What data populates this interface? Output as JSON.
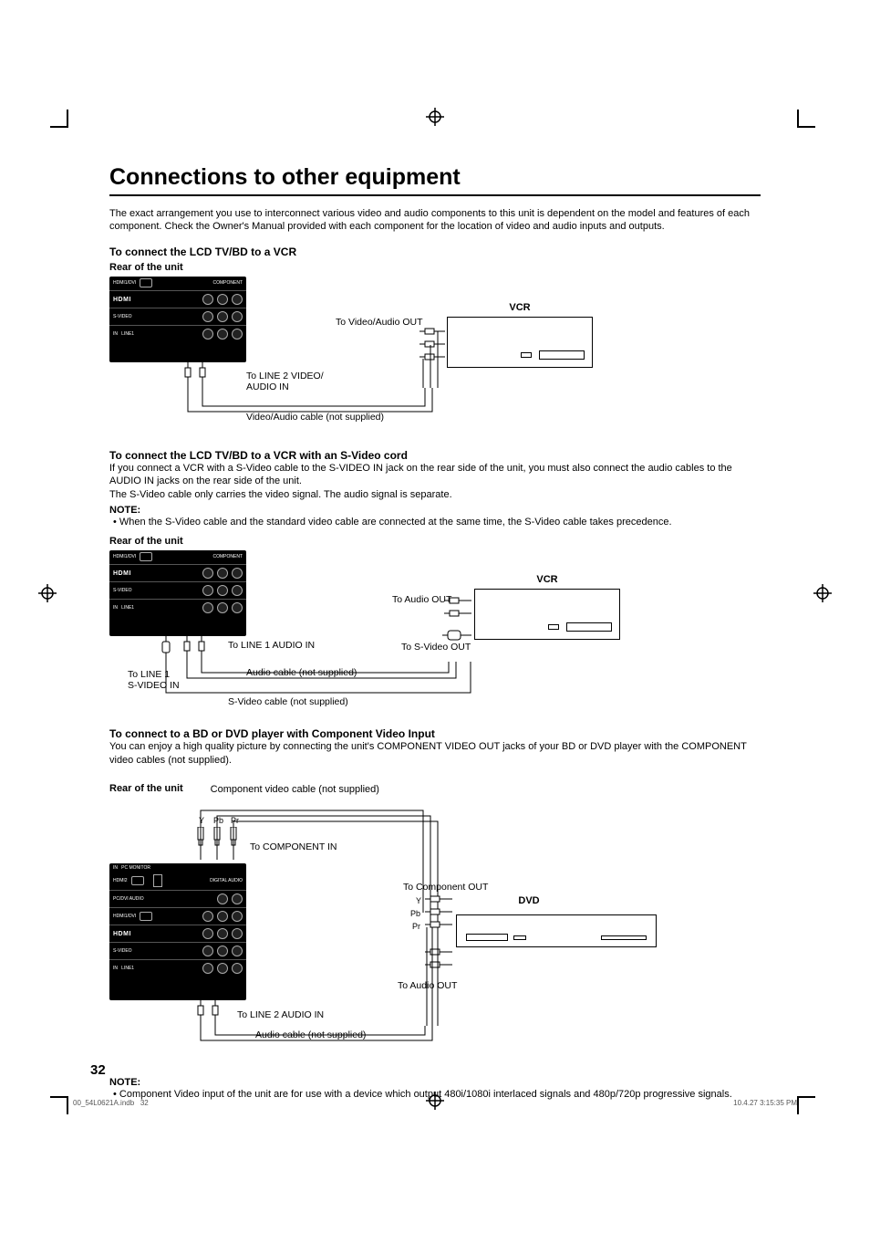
{
  "title": "Connections to other equipment",
  "intro": "The exact arrangement you use to interconnect various video and audio components to this unit is dependent on the model and features of each component. Check the Owner's Manual provided with each component for the location of video and audio inputs and outputs.",
  "section1": {
    "heading": "To connect the LCD TV/BD to a VCR",
    "rear_label": "Rear of the unit",
    "labels": {
      "to_line2": "To LINE 2 VIDEO/\nAUDIO IN",
      "cable": "Video/Audio cable (not supplied)",
      "to_va_out": "To Video/Audio OUT",
      "vcr": "VCR"
    }
  },
  "section2": {
    "heading": "To connect the LCD TV/BD to a VCR with an S-Video cord",
    "body1": "If you connect a VCR with a S-Video cable to the S-VIDEO IN jack on the rear side of the unit, you must also connect the audio cables to the AUDIO IN jacks on the rear side of the unit.",
    "body2": "The S-Video cable only carries the video signal. The audio signal is separate.",
    "note_heading": "NOTE:",
    "note_bullet": "•  When the S-Video cable and the standard video cable are connected at the same time, the S-Video cable takes precedence.",
    "rear_label": "Rear of the unit",
    "labels": {
      "to_line1_svideo": "To LINE 1\nS-VIDEO IN",
      "to_line1_audio": "To LINE 1 AUDIO IN",
      "audio_cable": "Audio cable (not supplied)",
      "svideo_cable": "S-Video cable (not supplied)",
      "to_audio_out": "To Audio OUT",
      "to_svideo_out": "To S-Video OUT",
      "vcr": "VCR"
    }
  },
  "section3": {
    "heading": "To connect to a BD or DVD player with Component Video Input",
    "body": "You can enjoy a high quality picture by connecting the unit's COMPONENT VIDEO OUT jacks of your BD or DVD player with the COMPONENT video cables (not supplied).",
    "rear_label": "Rear of the unit",
    "labels": {
      "component_cable": "Component video cable (not supplied)",
      "y": "Y",
      "pb": "Pb",
      "pr": "Pr",
      "to_component_in": "To COMPONENT IN",
      "to_component_out": "To Component OUT",
      "to_line2_audio": "To LINE 2 AUDIO IN",
      "audio_cable": "Audio cable (not supplied)",
      "to_audio_out": "To Audio OUT",
      "dvd": "DVD"
    },
    "note_heading": "NOTE:",
    "note_bullet": "•  Component Video input of the unit are for use with a device which output 480i/1080i interlaced signals and 480p/720p progressive signals."
  },
  "page_number": "32",
  "footer": {
    "left_file": "00_54L0621A.indb",
    "left_num": "32",
    "right": "10.4.27   3:15:35 PM"
  }
}
